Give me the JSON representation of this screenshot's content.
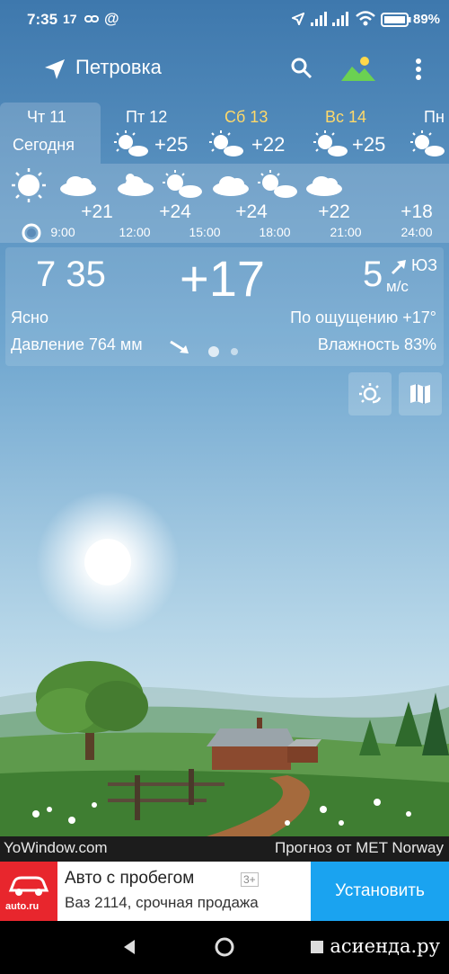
{
  "status_bar": {
    "time": "7:35",
    "notification_text": "17",
    "battery_percent": "89%"
  },
  "top_bar": {
    "location": "Петровка"
  },
  "day_tabs": [
    {
      "day": "Чт 11",
      "sub": "Сегодня",
      "temp": "",
      "weekend": false,
      "selected": true
    },
    {
      "day": "Пт 12",
      "sub": "",
      "temp": "+25",
      "weekend": false,
      "selected": false
    },
    {
      "day": "Сб 13",
      "sub": "",
      "temp": "+22",
      "weekend": true,
      "selected": false
    },
    {
      "day": "Вс 14",
      "sub": "",
      "temp": "+25",
      "weekend": true,
      "selected": false
    },
    {
      "day": "Пн",
      "sub": "",
      "temp": "",
      "weekend": false,
      "selected": false
    }
  ],
  "hourly": {
    "temps": [
      "+21",
      "+24",
      "+24",
      "+22",
      "+18"
    ],
    "times": [
      "9:00",
      "12:00",
      "15:00",
      "18:00",
      "21:00",
      "24:00"
    ],
    "icons": [
      "sun-icon",
      "cloud-icon",
      "partly-cloudy-icon",
      "partly-sunny-icon",
      "cloud-icon",
      "partly-sunny-icon",
      "cloud-icon"
    ]
  },
  "current": {
    "clock": "7 35",
    "temperature": "+17",
    "wind_speed": "5",
    "wind_direction": "ЮЗ",
    "wind_unit": "м/с",
    "condition": "Ясно",
    "feels_like": "По ощущению +17°",
    "pressure": "Давление 764 мм",
    "humidity": "Влажность 83%"
  },
  "footer": {
    "left": "YoWindow.com",
    "right": "Прогноз от MET Norway"
  },
  "ad": {
    "logo_text": "auto.ru",
    "title": "Авто с пробегом",
    "age_rating": "3+",
    "description": "Ваз 2114, срочная продажа",
    "install_label": "Установить"
  },
  "watermark": "асиенда.ру",
  "colors": {
    "sky_top": "#3e78ad",
    "sky_bottom": "#cfe3ee",
    "weekend": "#ffd96a",
    "ad_button": "#1aa3f0",
    "ad_logo": "#e8262d"
  }
}
